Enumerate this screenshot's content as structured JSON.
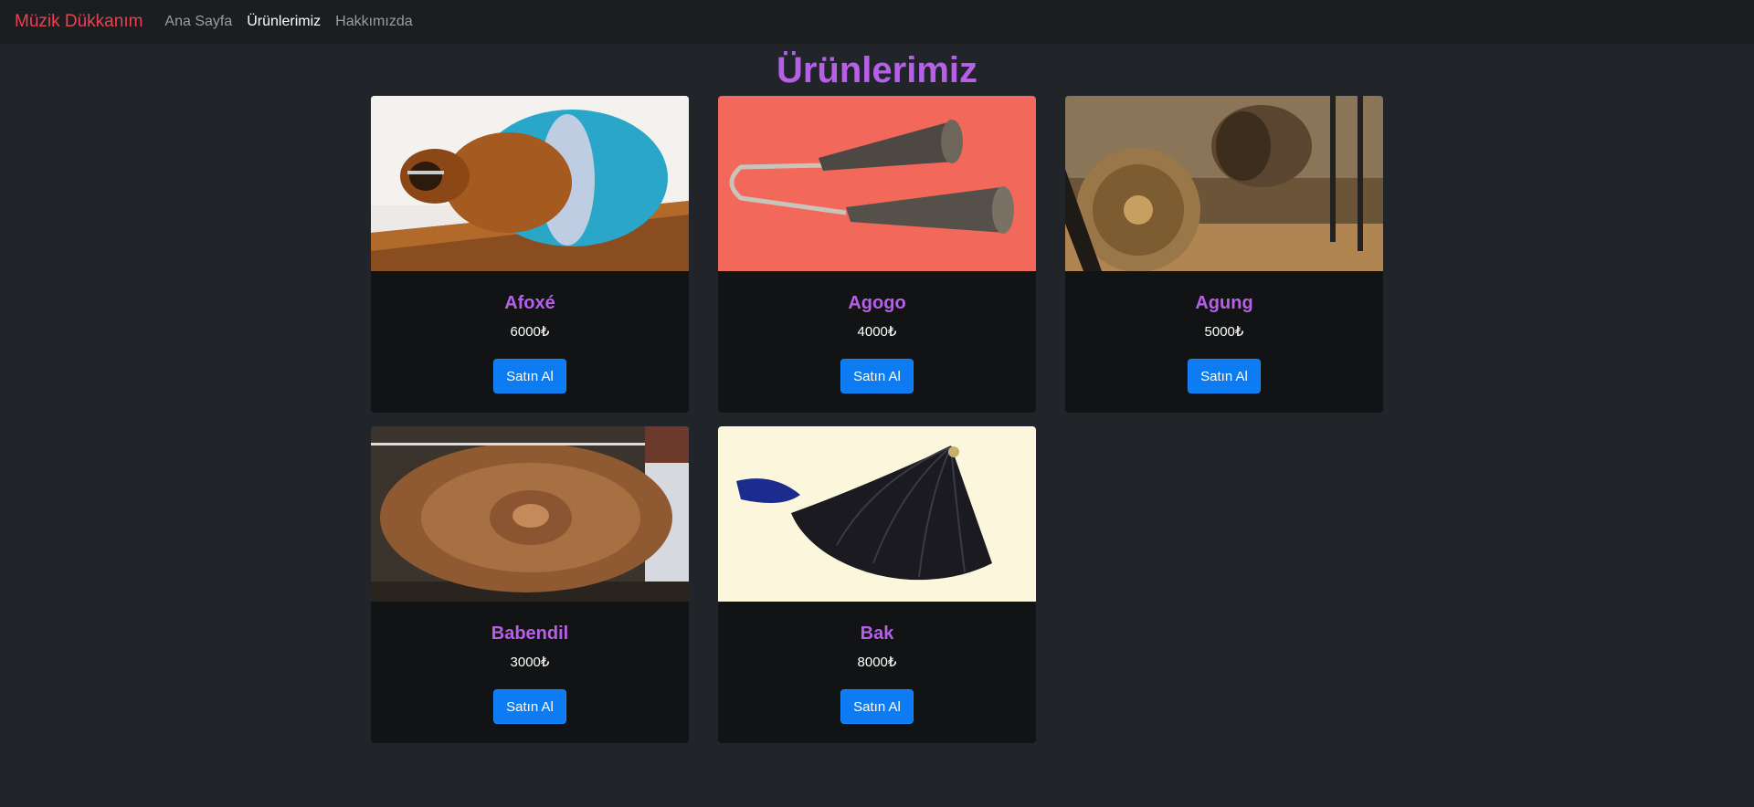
{
  "nav": {
    "brand": "Müzik Dükkanım",
    "links": [
      {
        "label": "Ana Sayfa",
        "active": false
      },
      {
        "label": "Ürünlerimiz",
        "active": true
      },
      {
        "label": "Hakkımızda",
        "active": false
      }
    ]
  },
  "page": {
    "title": "Ürünlerimiz"
  },
  "products": [
    {
      "name": "Afoxé",
      "price": "6000₺",
      "button": "Satın Al",
      "image": "afoxe-image"
    },
    {
      "name": "Agogo",
      "price": "4000₺",
      "button": "Satın Al",
      "image": "agogo-image"
    },
    {
      "name": "Agung",
      "price": "5000₺",
      "button": "Satın Al",
      "image": "agung-image"
    },
    {
      "name": "Babendil",
      "price": "3000₺",
      "button": "Satın Al",
      "image": "babendil-image"
    },
    {
      "name": "Bak",
      "price": "8000₺",
      "button": "Satın Al",
      "image": "bak-image"
    }
  ],
  "colors": {
    "brand": "#e8414f",
    "title": "#b660e8",
    "button": "#0d7cf2",
    "background": "#212529",
    "card": "#121314"
  }
}
